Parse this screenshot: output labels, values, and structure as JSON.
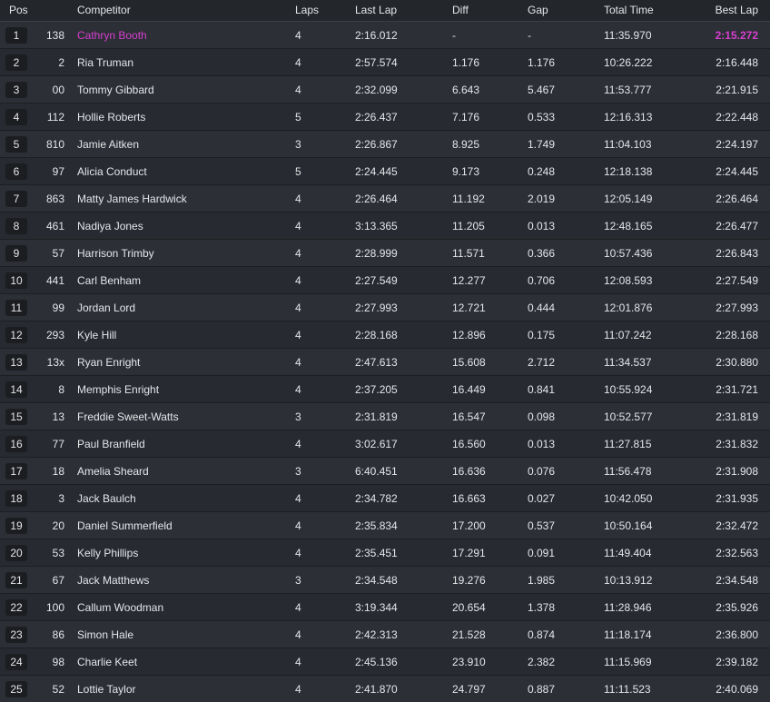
{
  "headers": {
    "pos": "Pos",
    "competitor": "Competitor",
    "laps": "Laps",
    "last_lap": "Last Lap",
    "diff": "Diff",
    "gap": "Gap",
    "total_time": "Total Time",
    "best_lap": "Best Lap"
  },
  "colors": {
    "highlight": "#d63fd0",
    "background": "#23262b"
  },
  "rows": [
    {
      "pos": "1",
      "num": "138",
      "name": "Cathryn Booth",
      "laps": "4",
      "last": "2:16.012",
      "diff": "-",
      "gap": "-",
      "total": "11:35.970",
      "best": "2:15.272",
      "leader": true
    },
    {
      "pos": "2",
      "num": "2",
      "name": "Ria Truman",
      "laps": "4",
      "last": "2:57.574",
      "diff": "1.176",
      "gap": "1.176",
      "total": "10:26.222",
      "best": "2:16.448"
    },
    {
      "pos": "3",
      "num": "00",
      "name": "Tommy Gibbard",
      "laps": "4",
      "last": "2:32.099",
      "diff": "6.643",
      "gap": "5.467",
      "total": "11:53.777",
      "best": "2:21.915"
    },
    {
      "pos": "4",
      "num": "112",
      "name": "Hollie Roberts",
      "laps": "5",
      "last": "2:26.437",
      "diff": "7.176",
      "gap": "0.533",
      "total": "12:16.313",
      "best": "2:22.448"
    },
    {
      "pos": "5",
      "num": "810",
      "name": "Jamie Aitken",
      "laps": "3",
      "last": "2:26.867",
      "diff": "8.925",
      "gap": "1.749",
      "total": "11:04.103",
      "best": "2:24.197"
    },
    {
      "pos": "6",
      "num": "97",
      "name": "Alicia Conduct",
      "laps": "5",
      "last": "2:24.445",
      "diff": "9.173",
      "gap": "0.248",
      "total": "12:18.138",
      "best": "2:24.445"
    },
    {
      "pos": "7",
      "num": "863",
      "name": "Matty James Hardwick",
      "laps": "4",
      "last": "2:26.464",
      "diff": "11.192",
      "gap": "2.019",
      "total": "12:05.149",
      "best": "2:26.464"
    },
    {
      "pos": "8",
      "num": "461",
      "name": "Nadiya Jones",
      "laps": "4",
      "last": "3:13.365",
      "diff": "11.205",
      "gap": "0.013",
      "total": "12:48.165",
      "best": "2:26.477"
    },
    {
      "pos": "9",
      "num": "57",
      "name": "Harrison Trimby",
      "laps": "4",
      "last": "2:28.999",
      "diff": "11.571",
      "gap": "0.366",
      "total": "10:57.436",
      "best": "2:26.843"
    },
    {
      "pos": "10",
      "num": "441",
      "name": "Carl Benham",
      "laps": "4",
      "last": "2:27.549",
      "diff": "12.277",
      "gap": "0.706",
      "total": "12:08.593",
      "best": "2:27.549"
    },
    {
      "pos": "11",
      "num": "99",
      "name": "Jordan Lord",
      "laps": "4",
      "last": "2:27.993",
      "diff": "12.721",
      "gap": "0.444",
      "total": "12:01.876",
      "best": "2:27.993"
    },
    {
      "pos": "12",
      "num": "293",
      "name": "Kyle Hill",
      "laps": "4",
      "last": "2:28.168",
      "diff": "12.896",
      "gap": "0.175",
      "total": "11:07.242",
      "best": "2:28.168"
    },
    {
      "pos": "13",
      "num": "13x",
      "name": "Ryan Enright",
      "laps": "4",
      "last": "2:47.613",
      "diff": "15.608",
      "gap": "2.712",
      "total": "11:34.537",
      "best": "2:30.880"
    },
    {
      "pos": "14",
      "num": "8",
      "name": "Memphis Enright",
      "laps": "4",
      "last": "2:37.205",
      "diff": "16.449",
      "gap": "0.841",
      "total": "10:55.924",
      "best": "2:31.721"
    },
    {
      "pos": "15",
      "num": "13",
      "name": "Freddie Sweet-Watts",
      "laps": "3",
      "last": "2:31.819",
      "diff": "16.547",
      "gap": "0.098",
      "total": "10:52.577",
      "best": "2:31.819"
    },
    {
      "pos": "16",
      "num": "77",
      "name": "Paul Branfield",
      "laps": "4",
      "last": "3:02.617",
      "diff": "16.560",
      "gap": "0.013",
      "total": "11:27.815",
      "best": "2:31.832"
    },
    {
      "pos": "17",
      "num": "18",
      "name": "Amelia Sheard",
      "laps": "3",
      "last": "6:40.451",
      "diff": "16.636",
      "gap": "0.076",
      "total": "11:56.478",
      "best": "2:31.908"
    },
    {
      "pos": "18",
      "num": "3",
      "name": "Jack Baulch",
      "laps": "4",
      "last": "2:34.782",
      "diff": "16.663",
      "gap": "0.027",
      "total": "10:42.050",
      "best": "2:31.935"
    },
    {
      "pos": "19",
      "num": "20",
      "name": "Daniel Summerfield",
      "laps": "4",
      "last": "2:35.834",
      "diff": "17.200",
      "gap": "0.537",
      "total": "10:50.164",
      "best": "2:32.472"
    },
    {
      "pos": "20",
      "num": "53",
      "name": "Kelly Phillips",
      "laps": "4",
      "last": "2:35.451",
      "diff": "17.291",
      "gap": "0.091",
      "total": "11:49.404",
      "best": "2:32.563"
    },
    {
      "pos": "21",
      "num": "67",
      "name": "Jack Matthews",
      "laps": "3",
      "last": "2:34.548",
      "diff": "19.276",
      "gap": "1.985",
      "total": "10:13.912",
      "best": "2:34.548"
    },
    {
      "pos": "22",
      "num": "100",
      "name": "Callum Woodman",
      "laps": "4",
      "last": "3:19.344",
      "diff": "20.654",
      "gap": "1.378",
      "total": "11:28.946",
      "best": "2:35.926"
    },
    {
      "pos": "23",
      "num": "86",
      "name": "Simon Hale",
      "laps": "4",
      "last": "2:42.313",
      "diff": "21.528",
      "gap": "0.874",
      "total": "11:18.174",
      "best": "2:36.800"
    },
    {
      "pos": "24",
      "num": "98",
      "name": "Charlie Keet",
      "laps": "4",
      "last": "2:45.136",
      "diff": "23.910",
      "gap": "2.382",
      "total": "11:15.969",
      "best": "2:39.182"
    },
    {
      "pos": "25",
      "num": "52",
      "name": "Lottie Taylor",
      "laps": "4",
      "last": "2:41.870",
      "diff": "24.797",
      "gap": "0.887",
      "total": "11:11.523",
      "best": "2:40.069"
    }
  ]
}
